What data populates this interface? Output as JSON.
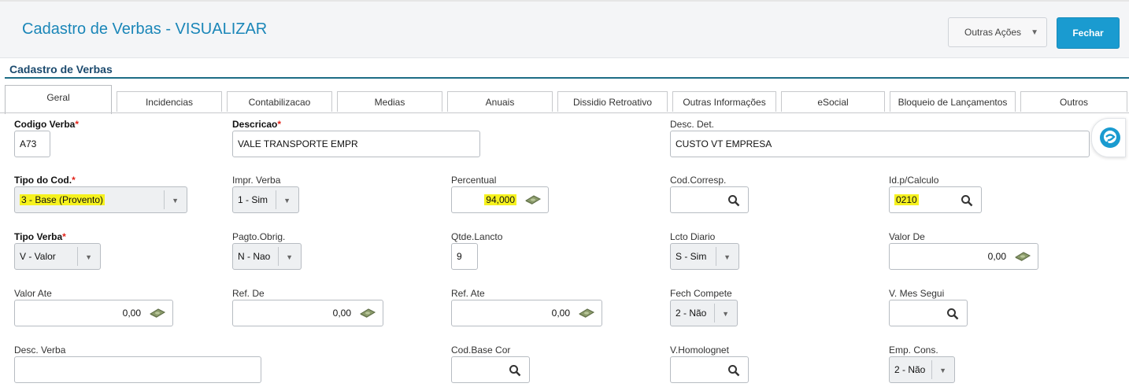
{
  "header": {
    "title": "Cadastro de Verbas - VISUALIZAR",
    "outras_acoes": "Outras Ações",
    "fechar": "Fechar"
  },
  "section": {
    "title": "Cadastro de Verbas"
  },
  "tabs": [
    {
      "label": "Geral",
      "active": true
    },
    {
      "label": "Incidencias"
    },
    {
      "label": "Contabilizacao"
    },
    {
      "label": "Medias"
    },
    {
      "label": "Anuais"
    },
    {
      "label": "Dissidio Retroativo"
    },
    {
      "label": "Outras Informações"
    },
    {
      "label": "eSocial"
    },
    {
      "label": "Bloqueio de Lançamentos"
    },
    {
      "label": "Outros"
    }
  ],
  "required_mark": "*",
  "fields": {
    "codigo_verba": {
      "label": "Codigo Verba",
      "value": "A73"
    },
    "descricao": {
      "label": "Descricao",
      "value": "VALE TRANSPORTE EMPR"
    },
    "desc_det": {
      "label": "Desc. Det.",
      "value": "CUSTO VT EMPRESA"
    },
    "tipo_cod": {
      "label": "Tipo do Cod.",
      "value": "3 - Base (Provento)"
    },
    "impr_verba": {
      "label": "Impr. Verba",
      "value": "1 - Sim"
    },
    "percentual": {
      "label": "Percentual",
      "value": "94,000"
    },
    "cod_corresp": {
      "label": "Cod.Corresp.",
      "value": ""
    },
    "id_calculo": {
      "label": "Id.p/Calculo",
      "value": "0210"
    },
    "tipo_verba": {
      "label": "Tipo Verba",
      "value": "V - Valor"
    },
    "pagto_obrig": {
      "label": "Pagto.Obrig.",
      "value": "N - Nao"
    },
    "qtde_lancto": {
      "label": "Qtde.Lancto",
      "value": "9"
    },
    "lcto_diario": {
      "label": "Lcto Diario",
      "value": "S - Sim"
    },
    "valor_de": {
      "label": "Valor De",
      "value": "0,00"
    },
    "valor_ate": {
      "label": "Valor Ate",
      "value": "0,00"
    },
    "ref_de": {
      "label": "Ref. De",
      "value": "0,00"
    },
    "ref_ate": {
      "label": "Ref. Ate",
      "value": "0,00"
    },
    "fech_compete": {
      "label": "Fech Compete",
      "value": "2 - Não"
    },
    "v_mes_segui": {
      "label": "V. Mes Segui",
      "value": ""
    },
    "desc_verba": {
      "label": "Desc. Verba",
      "value": ""
    },
    "cod_base_cor": {
      "label": "Cod.Base Cor",
      "value": ""
    },
    "v_homolognet": {
      "label": "V.Homolognet",
      "value": ""
    },
    "emp_cons": {
      "label": "Emp. Cons.",
      "value": "2 - Não"
    }
  },
  "colors": {
    "accent": "#1a9bd0",
    "title": "#1a86b8",
    "highlight": "#f6f21e",
    "required": "#e2231a"
  },
  "icons": {
    "money": "money-icon",
    "search": "search-icon",
    "dropdown": "chevron-down-icon",
    "chat": "chat-icon"
  }
}
